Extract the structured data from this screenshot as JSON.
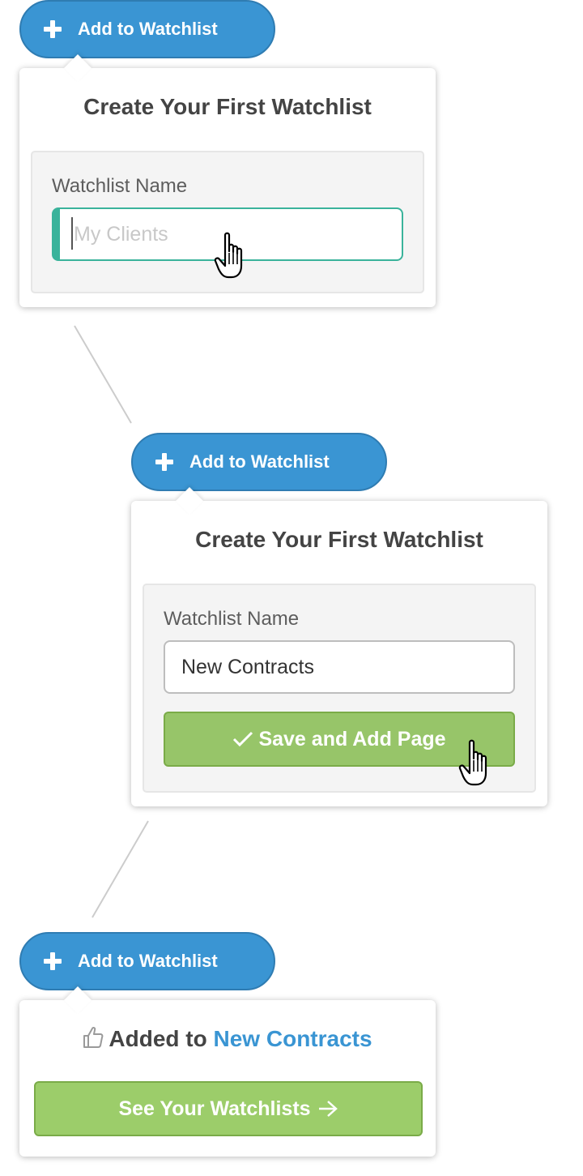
{
  "colors": {
    "primary_blue": "#3a95d3",
    "success_green": "#97c569",
    "focus_teal": "#3ab39b",
    "connector_gray": "#cccccc"
  },
  "step1": {
    "add_button_label": "Add to Watchlist",
    "popover_title": "Create Your First Watchlist",
    "field_label": "Watchlist Name",
    "input_placeholder": "My Clients",
    "input_value": ""
  },
  "step2": {
    "add_button_label": "Add to Watchlist",
    "popover_title": "Create Your First Watchlist",
    "field_label": "Watchlist Name",
    "input_value": "New Contracts",
    "save_button_label": "Save and Add Page"
  },
  "step3": {
    "add_button_label": "Add to Watchlist",
    "added_prefix": "Added to",
    "added_list_name": "New Contracts",
    "see_button_label": "See Your Watchlists"
  },
  "icons": {
    "plus": "plus-icon",
    "check": "check-icon",
    "thumbs_up": "thumbs-up-icon",
    "arrow_right": "arrow-right-icon",
    "pointer": "hand-pointer-cursor-icon"
  }
}
